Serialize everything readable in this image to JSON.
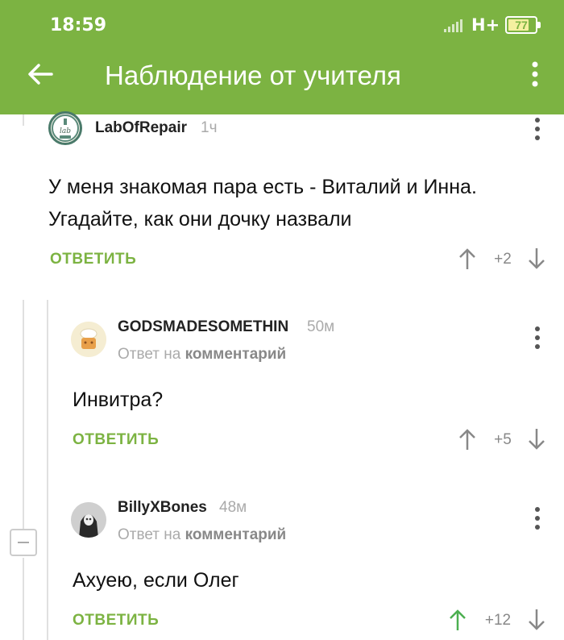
{
  "status_bar": {
    "time": "18:59",
    "network": "H+",
    "battery": "77",
    "battery_level": 0.77
  },
  "app_bar": {
    "title": "Наблюдение от учителя"
  },
  "comments": [
    {
      "username": "LabOfRepair",
      "time": "1ч",
      "text_lines": [
        "У меня знакомая пара есть - Виталий и Инна.",
        "Угадайте, как они дочку назвали"
      ],
      "reply_label": "ОТВЕТИТЬ",
      "score": "+2",
      "avatar_text": "lab"
    },
    {
      "username": "GODSMADESOMETHIN",
      "time": "50м",
      "reply_prefix": "Ответ на",
      "reply_target": "комментарий",
      "text_lines": [
        "Инвитра?"
      ],
      "reply_label": "ОТВЕТИТЬ",
      "score": "+5"
    },
    {
      "username": "BillyXBones",
      "time": "48м",
      "reply_prefix": "Ответ на",
      "reply_target": "комментарий",
      "text_lines": [
        "Ахуею, если Олег"
      ],
      "reply_label": "ОТВЕТИТЬ",
      "score": "+12",
      "upvoted": true
    }
  ],
  "colors": {
    "accent": "#7cb342",
    "upvote_active": "#4caf50",
    "icon_grey": "#888888"
  },
  "icons": {
    "back": "arrow-left-icon",
    "menu": "more-vertical-icon",
    "up": "arrow-up-icon",
    "down": "arrow-down-icon",
    "collapse": "minus-square-icon"
  }
}
